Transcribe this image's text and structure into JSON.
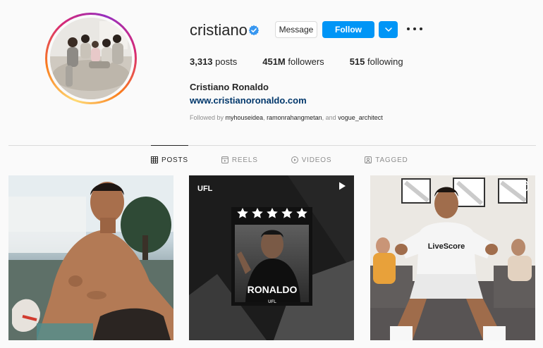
{
  "profile": {
    "username": "cristiano",
    "verified_icon": "verified-badge-icon",
    "message_label": "Message",
    "follow_label": "Follow",
    "full_name": "Cristiano Ronaldo",
    "website": "www.cristianoronaldo.com",
    "followed_by_prefix": "Followed by ",
    "followed_by_users": [
      "myhouseidea",
      "ramonrahangmetan"
    ],
    "followed_by_and": ", and ",
    "followed_by_last": "vogue_architect"
  },
  "stats": {
    "posts_count": "3,313",
    "posts_label": " posts",
    "followers_count": "451M",
    "followers_label": " followers",
    "following_count": "515",
    "following_label": " following"
  },
  "tabs": [
    {
      "label": "POSTS",
      "icon": "grid-icon",
      "active": true
    },
    {
      "label": "REELS",
      "icon": "reels-icon",
      "active": false
    },
    {
      "label": "VIDEOS",
      "icon": "video-icon",
      "active": false
    },
    {
      "label": "TAGGED",
      "icon": "tagged-icon",
      "active": false
    }
  ],
  "posts": [
    {
      "corner_icon": "",
      "overlay_text": []
    },
    {
      "corner_icon": "reel-play-icon",
      "overlay_text": [
        "UFL",
        "RONALDO",
        "UFL"
      ]
    },
    {
      "corner_icon": "reels-icon",
      "overlay_text": [
        "LiveScore"
      ]
    }
  ],
  "colors": {
    "accent": "#0095f6",
    "link": "#00376b",
    "muted": "#8e8e8e",
    "text": "#262626",
    "border": "#dbdbdb"
  }
}
